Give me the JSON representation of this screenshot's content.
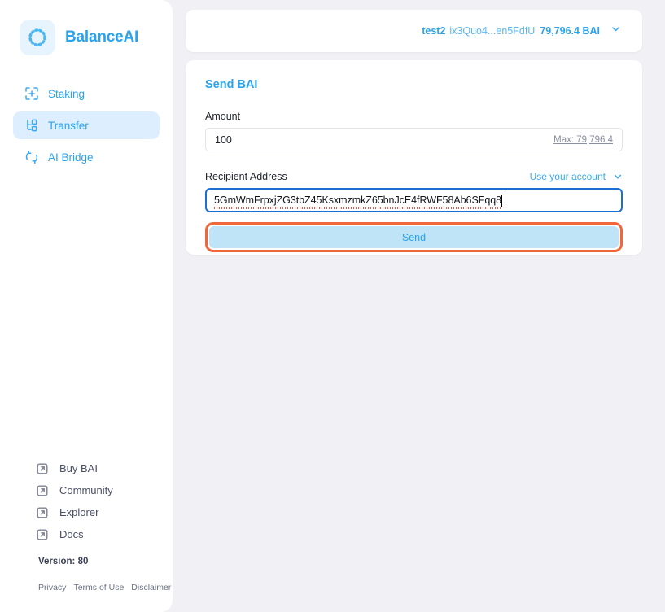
{
  "app": {
    "brand_name": "BalanceAI",
    "logo_icon": "dotted-circle-logo"
  },
  "sidebar": {
    "nav_items": [
      {
        "label": "Staking",
        "icon": "staking-plus-icon",
        "active": false
      },
      {
        "label": "Transfer",
        "icon": "transfer-node-icon",
        "active": true
      },
      {
        "label": "AI Bridge",
        "icon": "bridge-refresh-icon",
        "active": false
      }
    ],
    "external_links": [
      {
        "label": "Buy BAI",
        "icon": "external-link-icon"
      },
      {
        "label": "Community",
        "icon": "external-link-icon"
      },
      {
        "label": "Explorer",
        "icon": "external-link-icon"
      },
      {
        "label": "Docs",
        "icon": "external-link-icon"
      }
    ],
    "version": "Version: 80",
    "legal_links": [
      "Privacy",
      "Terms of Use",
      "Disclaimer"
    ]
  },
  "header": {
    "account_name": "test2",
    "account_address": "ix3Quo4...en5FdfU",
    "account_balance": "79,796.4 BAI",
    "chevron_icon": "chevron-down-icon"
  },
  "send_form": {
    "title": "Send BAI",
    "amount_label": "Amount",
    "amount_value": "100",
    "amount_placeholder": "Amount",
    "max_link": "Max: 79,796.4",
    "recipient_label": "Recipient Address",
    "use_account_label": "Use your account",
    "use_account_chevron": "chevron-down-icon",
    "recipient_value": "5GmWmFrpxjZG3tbZ45KsxmzmkZ65bnJcE4fRWF58Ab6SFqq8",
    "recipient_placeholder": "Recipient Address",
    "send_label": "Send"
  },
  "colors": {
    "brand_blue": "#2aa3ef",
    "page_bg": "#f1f1f5",
    "active_nav_bg": "#dceeff",
    "highlight_ring": "#f2663c",
    "send_button_bg": "#bfe3f7",
    "focus_border": "#1a6fd4"
  }
}
